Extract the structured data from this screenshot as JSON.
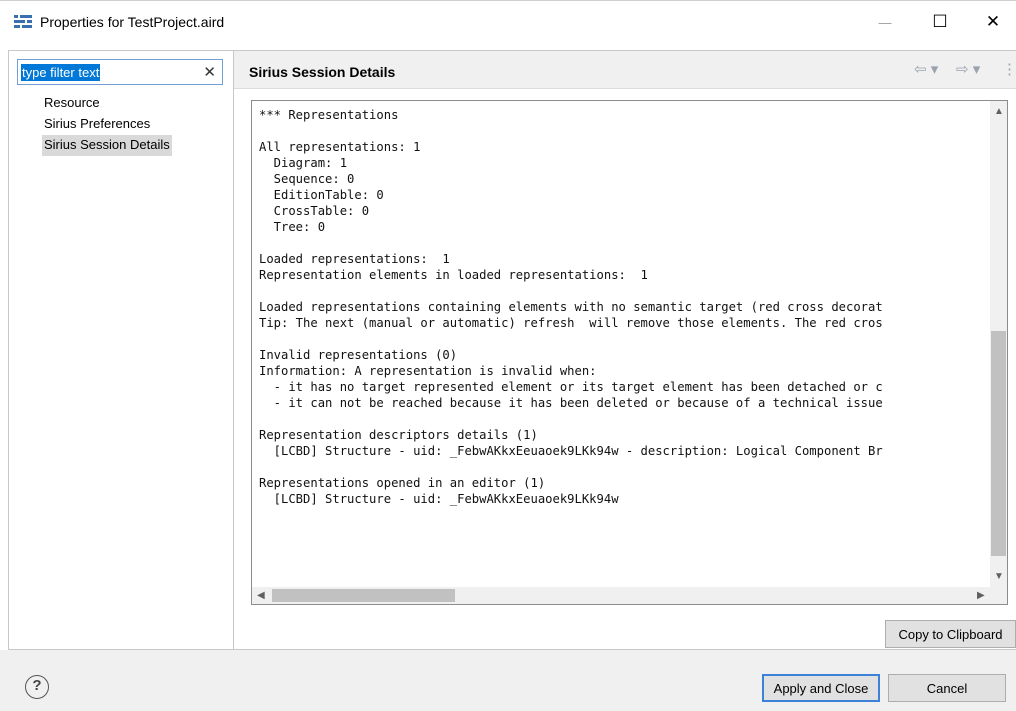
{
  "window": {
    "title": "Properties for TestProject.aird",
    "minimize": "—",
    "maximize": "☐",
    "close": "✕"
  },
  "filter": {
    "text": "type filter text",
    "clear": "✕"
  },
  "nav": {
    "items": [
      {
        "label": "Resource",
        "selected": false
      },
      {
        "label": "Sirius Preferences",
        "selected": false
      },
      {
        "label": "Sirius Session Details",
        "selected": true
      }
    ]
  },
  "page": {
    "title": "Sirius Session Details",
    "back_icon": "⇦ ▾",
    "forward_icon": "⇨ ▾",
    "menu_icon": "⋮"
  },
  "details_lines": [
    "*** Representations",
    "",
    "All representations: 1",
    "  Diagram: 1",
    "  Sequence: 0",
    "  EditionTable: 0",
    "  CrossTable: 0",
    "  Tree: 0",
    "",
    "Loaded representations:  1",
    "Representation elements in loaded representations:  1",
    "",
    "Loaded representations containing elements with no semantic target (red cross decorat",
    "Tip: The next (manual or automatic) refresh  will remove those elements. The red cros",
    "",
    "Invalid representations (0)",
    "Information: A representation is invalid when:",
    "  - it has no target represented element or its target element has been detached or c",
    "  - it can not be reached because it has been deleted or because of a technical issue",
    "",
    "Representation descriptors details (1)",
    "  [LCBD] Structure - uid: _FebwAKkxEeuaoek9LKk94w - description: Logical Component Br",
    "",
    "Representations opened in an editor (1)",
    "  [LCBD] Structure - uid: _FebwAKkxEeuaoek9LKk94w"
  ],
  "buttons": {
    "copy": "Copy to Clipboard",
    "apply": "Apply and Close",
    "cancel": "Cancel",
    "help": "?"
  }
}
